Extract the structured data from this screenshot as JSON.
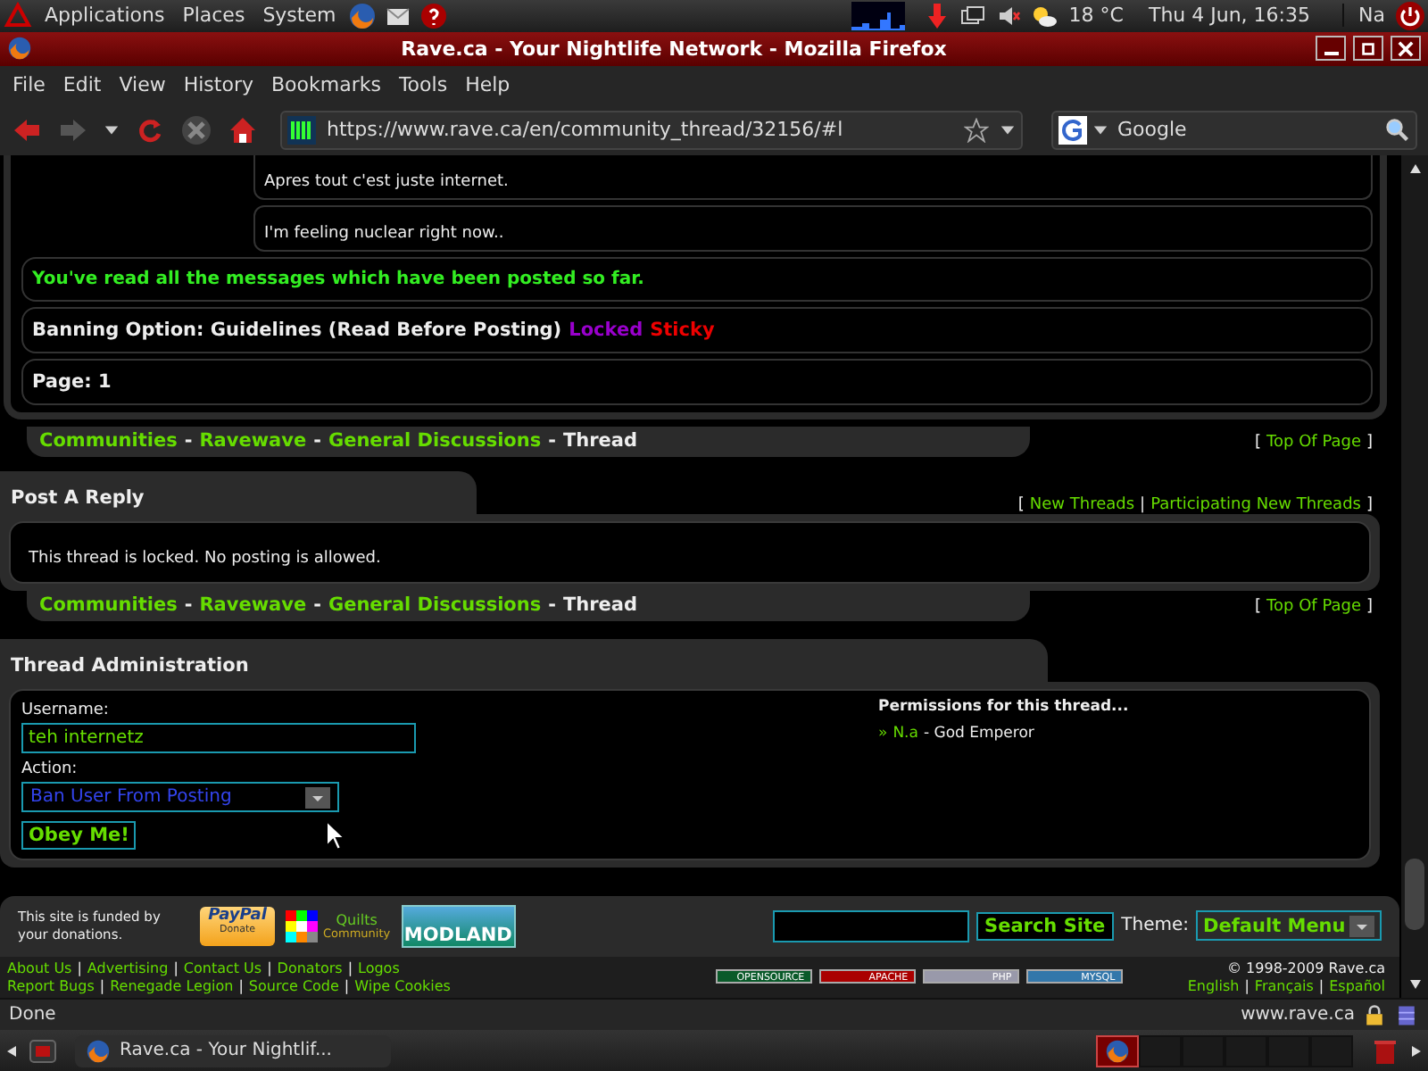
{
  "top_panel": {
    "menus": [
      "Applications",
      "Places",
      "System"
    ],
    "weather": "18 °C",
    "clock": "Thu  4 Jun, 16:35",
    "user": "Na"
  },
  "window": {
    "title": "Rave.ca - Your Nightlife Network - Mozilla Firefox"
  },
  "menu_bar": [
    "File",
    "Edit",
    "View",
    "History",
    "Bookmarks",
    "Tools",
    "Help"
  ],
  "address_bar": {
    "url": "https://www.rave.ca/en/community_thread/32156/#l"
  },
  "search_box": {
    "placeholder": "Google"
  },
  "thread": {
    "replies": [
      "Apres tout c'est juste internet.",
      "I'm feeling nuclear right now.."
    ],
    "read_notice": "You've read all the messages which have been posted so far.",
    "title": "Banning Option: Guidelines (Read Before Posting)",
    "tags": [
      {
        "label": "Locked",
        "color": "#9900cc"
      },
      {
        "label": "Sticky",
        "color": "#ee0000"
      }
    ],
    "page": "Page: 1"
  },
  "breadcrumbs": [
    {
      "items": [
        "Communities",
        "Ravewave",
        "General Discussions"
      ],
      "current": "Thread",
      "separator": "-",
      "top_link": "Top Of Page"
    },
    {
      "items": [
        "Communities",
        "Ravewave",
        "General Discussions"
      ],
      "current": "Thread",
      "separator": "-",
      "top_link": "Top Of Page"
    }
  ],
  "brackets": {
    "open": "[",
    "close": "]",
    "separator": "|"
  },
  "post_reply": {
    "title": "Post A Reply",
    "links": [
      "New Threads",
      "Participating New Threads"
    ],
    "message": "This thread is locked. No posting is allowed."
  },
  "admin": {
    "title": "Thread Administration",
    "username_label": "Username:",
    "username": "teh internetz",
    "action_label": "Action:",
    "action": "Ban User From Posting",
    "submit": "Obey Me!",
    "permissions_title": "Permissions for this thread...",
    "permissions": [
      {
        "marker": "»",
        "user": "N.a",
        "role": "- God Emperor"
      }
    ]
  },
  "footer": {
    "funded": "This site is funded by your donations.",
    "sponsors": [
      {
        "kind": "paypal",
        "label": "PayPal",
        "sublabel": "Donate"
      },
      {
        "kind": "quilts",
        "label": "Quilts",
        "sublabel": "Community"
      },
      {
        "kind": "modland",
        "label": "MODLAND"
      }
    ],
    "search_button": "Search Site",
    "theme_label": "Theme:",
    "theme": "Default Menu",
    "link_rows": [
      [
        "About Us",
        "Advertising",
        "Contact Us",
        "Donators",
        "Logos"
      ],
      [
        "Report Bugs",
        "Renegade Legion",
        "Source Code",
        "Wipe Cookies"
      ]
    ],
    "badges": [
      {
        "kind": "opensource",
        "label": "OPENSOURCE"
      },
      {
        "kind": "apache",
        "label": "APACHE"
      },
      {
        "kind": "php",
        "label": "PHP"
      },
      {
        "kind": "mysql",
        "label": "MYSQL"
      }
    ],
    "copyright": "© 1998-2009 Rave.ca",
    "languages": [
      "English",
      "Français",
      "Español"
    ]
  },
  "status_bar": {
    "text": "Done",
    "host": "www.rave.ca"
  },
  "taskbar": {
    "tasks": [
      "Rave.ca - Your Nightlif..."
    ]
  }
}
